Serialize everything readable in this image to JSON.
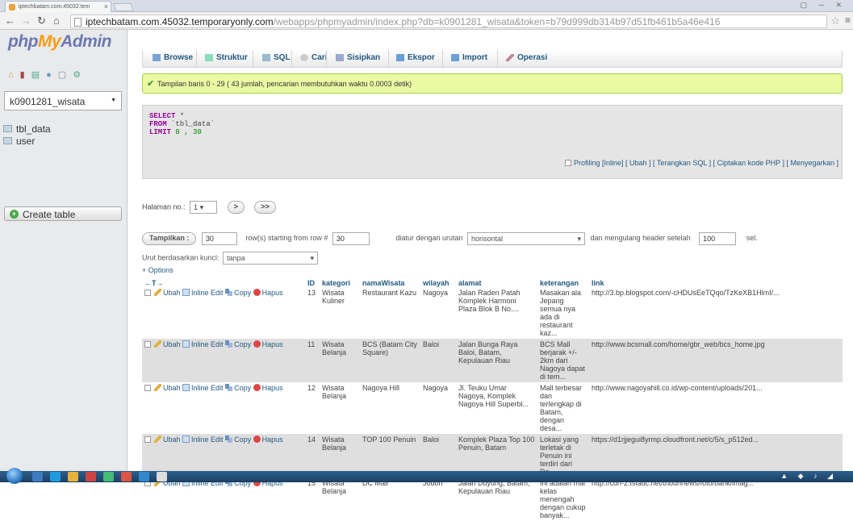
{
  "browser": {
    "tab_title": "iptechbatam.com.45032.tem",
    "tab_close": "×",
    "url_host": "iptechbatam.com.45032.temporaryonly.com",
    "url_path": "/webapps/phpmyadmin/index.php?db=k0901281_wisata&token=b79d999db314b97d51fb461b5a46e416"
  },
  "sidebar": {
    "logo_php": "php",
    "logo_my": "My",
    "logo_admin": "Admin",
    "db_selected": "k0901281_wisata",
    "tables": [
      "tbl_data",
      "user"
    ],
    "create_table": "Create table"
  },
  "menu": {
    "browse": "Browse",
    "struktur": "Struktur",
    "sql": "SQL",
    "cari": "Cari",
    "sisipkan": "Sisipkan",
    "ekspor": "Ekspor",
    "import": "Import",
    "operasi": "Operasi"
  },
  "message": "Tampilan baris 0 - 29 ( 43 jumlah, pencarian membutuhkan waktu 0.0003 detik)",
  "sql": {
    "select_kw": "SELECT",
    "select_rest": " *",
    "from_kw": "FROM",
    "from_rest": " `tbl_data`",
    "limit_kw": "LIMIT",
    "limit_rest": " 0 , 30",
    "links": "Profiling [Inline] [ Ubah ] [ Terangkan SQL ] [ Ciptakan kode PHP ] [ Menyegarkan ]"
  },
  "nav": {
    "halaman_label": "Halaman no.:",
    "halaman_value": "1",
    "next": ">",
    "last": ">>",
    "tampilkan": "Tampilkan :",
    "rows_value": "30",
    "rows_label": "row(s) starting from row #",
    "start_value": "30",
    "diatur_label": "diatur dengan urutan",
    "diatur_value": "horisontal",
    "mengulang_label": "dan mengulang header setelah",
    "mengulang_value": "100",
    "sel_label": "sel.",
    "urut_label": "Urut berdasarkan kunci:",
    "urut_value": "tanpa",
    "options": "+ Options"
  },
  "table": {
    "headers": {
      "arrows": "←T→",
      "id": "ID",
      "kategori": "kategori",
      "nama": "namaWisata",
      "wilayah": "wilayah",
      "alamat": "alamat",
      "keterangan": "keterangan",
      "link": "link"
    },
    "actions": {
      "ubah": "Ubah",
      "inline": "Inline Edit",
      "copy": "Copy",
      "hapus": "Hapus"
    },
    "rows": [
      {
        "id": "13",
        "kategori": "Wisata Kuliner",
        "nama": "Restaurant Kazu",
        "wilayah": "Nagoya",
        "alamat": "Jalan Raden Patah Komplek Harmoni Plaza Blok B No....",
        "keterangan": "Masakan ala Jepang semua nya ada di restaurant kaz...",
        "link": "http://3.bp.blogspot.com/-cHDUsEeTQqo/TzKeXB1HlmI/..."
      },
      {
        "id": "11",
        "kategori": "Wisata Belanja",
        "nama": "BCS (Batam City Square)",
        "wilayah": "Baloi",
        "alamat": "Jalan Bunga Raya Baloi, Batam, Kepulauan Riau",
        "keterangan": "BCS Mall berjarak +/- 2km dari Nagoya dapat di tem...",
        "link": "http://www.bcsmall.com/home/gbr_web/bcs_home.jpg"
      },
      {
        "id": "12",
        "kategori": "Wisata Belanja",
        "nama": "Nagoya Hill",
        "wilayah": "Nagoya",
        "alamat": "Jl. Teuku Umar Nagoya, Komplek Nagoya Hill Superbl...",
        "keterangan": "Mall terbesar dan terlengkap di Batam, dengan desa...",
        "link": "http://www.nagoyahill.co.id/wp-content/uploads/201..."
      },
      {
        "id": "14",
        "kategori": "Wisata Belanja",
        "nama": "TOP 100 Penuin",
        "wilayah": "Baloi",
        "alamat": "Komplek Plaza Top 100 Penuin, Batam",
        "keterangan": "Lokasi yang terletak di Penuin ini terdiri dari De...",
        "link": "https://d1rjjegui8yrmp.cloudfront.net/c/5/s_p512ed..."
      },
      {
        "id": "15",
        "kategori": "Wisata Belanja",
        "nama": "DC Mall",
        "wilayah": "Jodoh",
        "alamat": "Jalan Duyung, Batam, Kepulauan Riau",
        "keterangan": "Ini adalah mal kelas menengah dengan cukup banyak...",
        "link": "http://cdn-2.tstatic.net/tribunnews/foto/bank/imag..."
      }
    ]
  }
}
